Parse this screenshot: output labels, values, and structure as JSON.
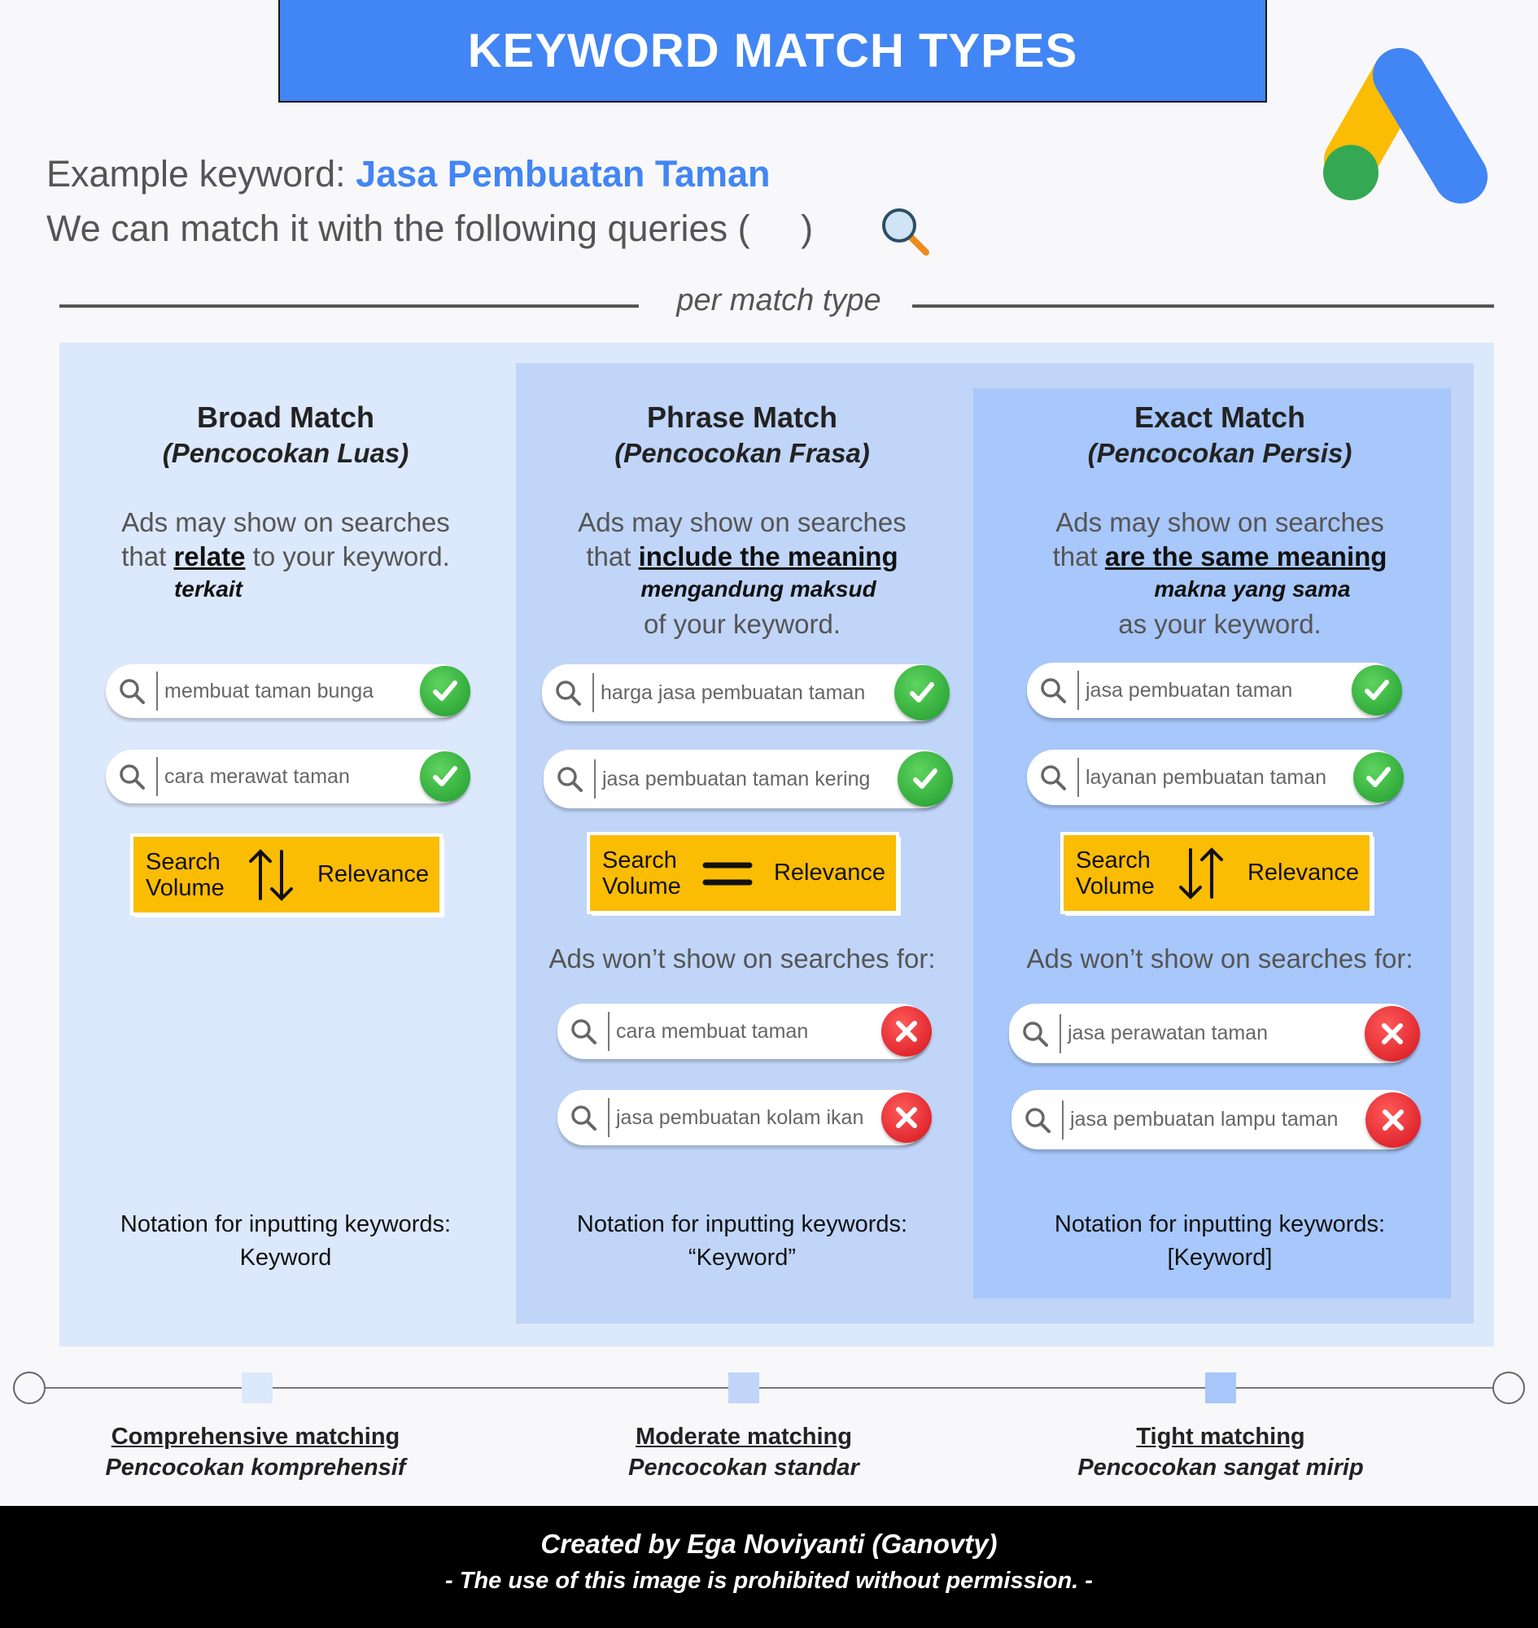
{
  "title": "KEYWORD MATCH TYPES",
  "intro": {
    "example_label": "Example keyword:",
    "example_keyword": "Jasa Pembuatan Taman",
    "queries_line": "We can match it with the following queries (     )"
  },
  "divider_label": "per match type",
  "colors": {
    "brand_blue": "#4285f4",
    "yellow": "#fbbc04",
    "green": "#34a853",
    "red": "#d4141c"
  },
  "relevance": {
    "search_volume_line1": "Search",
    "search_volume_line2": "Volume",
    "relevance": "Relevance"
  },
  "columns": [
    {
      "heading": "Broad Match",
      "subheading": "(Pencocokan Luas)",
      "desc_line1": "Ads may show on searches",
      "desc_pre": "that ",
      "desc_key": "relate",
      "desc_post": " to your keyword.",
      "gloss": "terkait",
      "matches": [
        "membuat taman bunga",
        "cara merawat taman"
      ],
      "relation": "up-down-arrows",
      "notation_label": "Notation for inputting keywords:",
      "notation": "Keyword"
    },
    {
      "heading": "Phrase Match",
      "subheading": "(Pencocokan Frasa)",
      "desc_line1": "Ads may show on searches",
      "desc_pre": "that ",
      "desc_key": "include the meaning",
      "gloss": "mengandung maksud",
      "desc_line3": "of your keyword.",
      "matches": [
        "harga jasa pembuatan taman",
        "jasa pembuatan taman kering"
      ],
      "relation": "equals",
      "wont_label": "Ads won’t show on searches for:",
      "non_matches": [
        "cara membuat taman",
        "jasa pembuatan kolam ikan"
      ],
      "notation_label": "Notation for inputting keywords:",
      "notation": "“Keyword”"
    },
    {
      "heading": "Exact Match",
      "subheading": "(Pencocokan Persis)",
      "desc_line1": "Ads may show on searches",
      "desc_pre": "that ",
      "desc_key": "are the same meaning",
      "gloss": "makna yang sama",
      "desc_line3": "as your keyword.",
      "matches": [
        "jasa pembuatan taman",
        "layanan pembuatan taman"
      ],
      "relation": "down-up-arrows",
      "wont_label": "Ads won’t show on searches for:",
      "non_matches": [
        "jasa perawatan taman",
        "jasa pembuatan lampu taman"
      ],
      "notation_label": "Notation for inputting keywords:",
      "notation": "[Keyword]"
    }
  ],
  "scale": [
    {
      "label": "Comprehensive matching",
      "sub": "Pencocokan komprehensif"
    },
    {
      "label": "Moderate matching",
      "sub": "Pencocokan standar"
    },
    {
      "label": "Tight matching",
      "sub": "Pencocokan sangat mirip"
    }
  ],
  "footer": {
    "credit": "Created by Ega Noviyanti (Ganovty)",
    "notice": "- The use of this image is prohibited without permission. -"
  }
}
